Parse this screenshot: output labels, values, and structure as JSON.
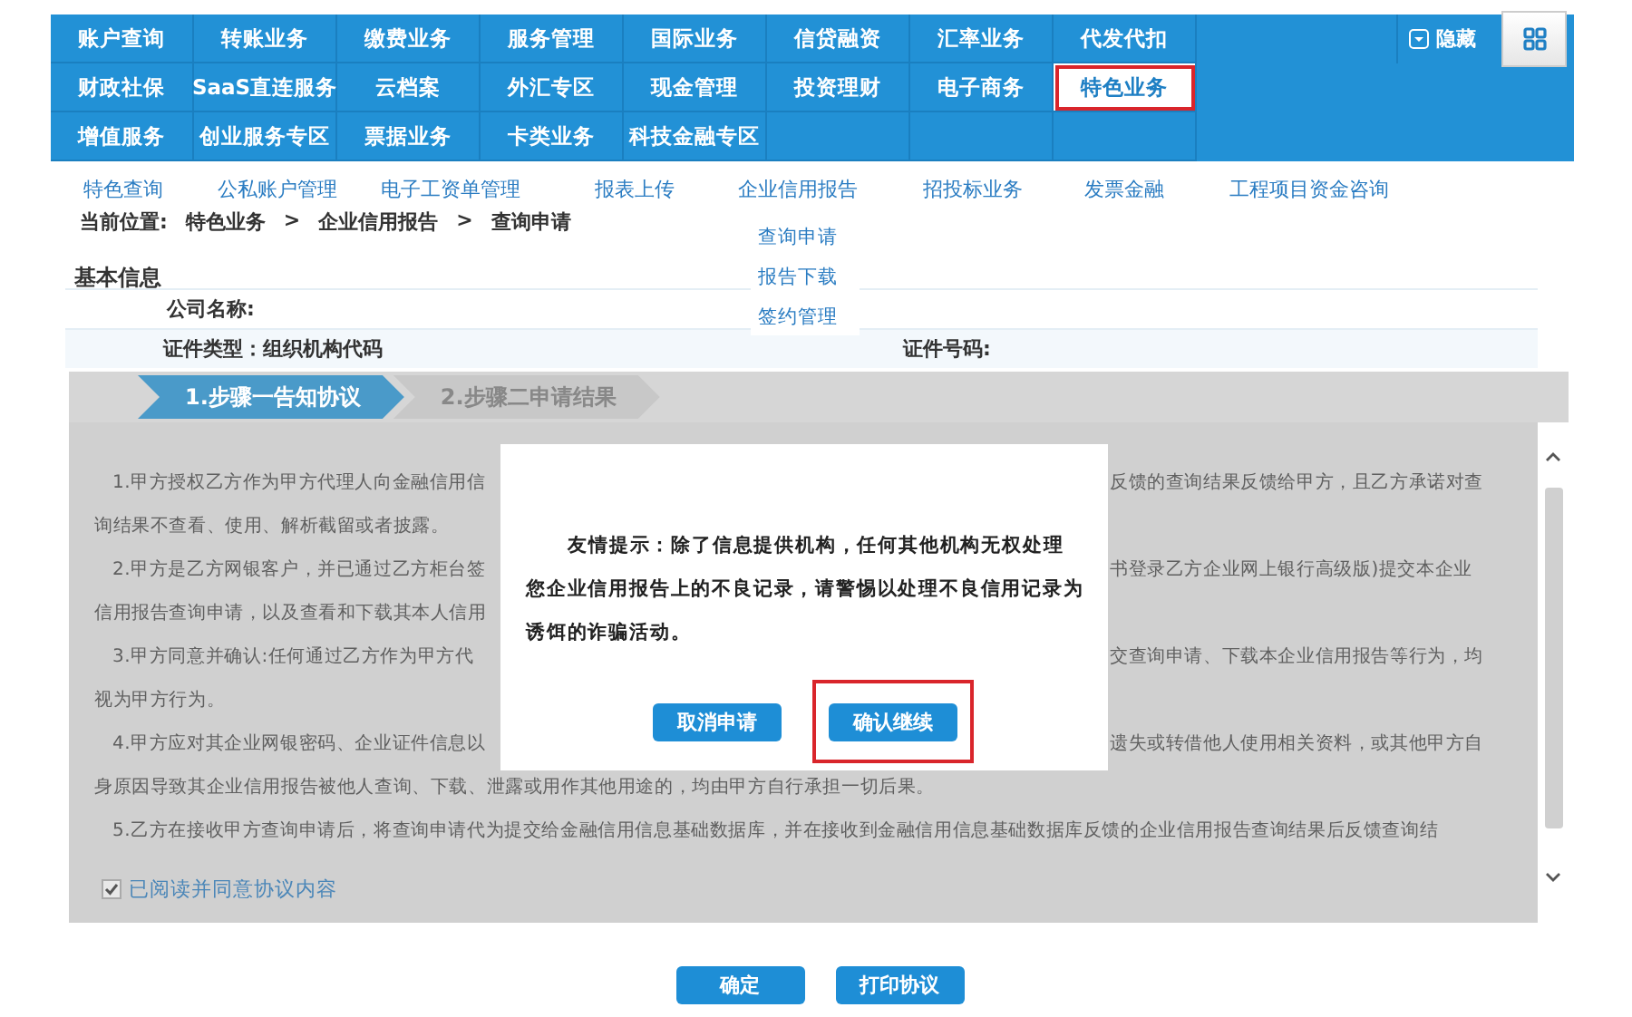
{
  "nav": {
    "rows": [
      [
        {
          "label": "账户查询",
          "selected": false
        },
        {
          "label": "转账业务",
          "selected": false
        },
        {
          "label": "缴费业务",
          "selected": false
        },
        {
          "label": "服务管理",
          "selected": false
        },
        {
          "label": "国际业务",
          "selected": false
        },
        {
          "label": "信贷融资",
          "selected": false
        },
        {
          "label": "汇率业务",
          "selected": false
        },
        {
          "label": "代发代扣",
          "selected": false
        }
      ],
      [
        {
          "label": "财政社保",
          "selected": false
        },
        {
          "label": "SaaS直连服务",
          "selected": false
        },
        {
          "label": "云档案",
          "selected": false
        },
        {
          "label": "外汇专区",
          "selected": false
        },
        {
          "label": "现金管理",
          "selected": false
        },
        {
          "label": "投资理财",
          "selected": false
        },
        {
          "label": "电子商务",
          "selected": false
        },
        {
          "label": "特色业务",
          "selected": true
        }
      ],
      [
        {
          "label": "增值服务",
          "selected": false
        },
        {
          "label": "创业服务专区",
          "selected": false
        },
        {
          "label": "票据业务",
          "selected": false
        },
        {
          "label": "卡类业务",
          "selected": false
        },
        {
          "label": "科技金融专区",
          "selected": false
        }
      ]
    ],
    "hide_toggle": "隐藏"
  },
  "subnav": [
    "特色查询",
    "公私账户管理",
    "电子工资单管理",
    "报表上传",
    "企业信用报告",
    "招投标业务",
    "发票金融",
    "工程项目资金咨询"
  ],
  "dropdown": [
    "查询申请",
    "报告下载",
    "签约管理"
  ],
  "breadcrumb": {
    "label": "当前位置:",
    "path": [
      "特色业务",
      "企业信用报告",
      "查询申请"
    ],
    "separators": [
      ">",
      ">"
    ]
  },
  "basic_info": {
    "title": "基本信息",
    "company_label": "公司名称:",
    "id_type": "证件类型：组织机构代码",
    "id_number_label": "证件号码:"
  },
  "steps": [
    {
      "label": "1.步骤一告知协议",
      "selected": true
    },
    {
      "label": "2.步骤二申请结果",
      "selected": false
    }
  ],
  "agreement": {
    "paragraphs": [
      {
        "lines": [
          {
            "kind": "split",
            "left": "1.甲方授权乙方作为甲方代理人向金融信用信",
            "right": "反馈的查询结果反馈给甲方，且乙方承诺对查"
          },
          {
            "kind": "full",
            "left": "询结果不查看、使用、解析截留或者披露。"
          }
        ]
      },
      {
        "lines": [
          {
            "kind": "split",
            "left": "2.甲方是乙方网银客户，并已通过乙方柜台签",
            "right": "书登录乙方企业网上银行高级版)提交本企业"
          },
          {
            "kind": "split",
            "left": "信用报告查询申请，以及查看和下载其本人信用"
          }
        ]
      },
      {
        "lines": [
          {
            "kind": "split",
            "left": "3.甲方同意并确认:任何通过乙方作为甲方代",
            "right": "交查询申请、下载本企业信用报告等行为，均"
          },
          {
            "kind": "full",
            "left": "视为甲方行为。"
          }
        ]
      },
      {
        "lines": [
          {
            "kind": "split",
            "left": "4.甲方应对其企业网银密码、企业证件信息以",
            "right": "遗失或转借他人使用相关资料，或其他甲方自"
          },
          {
            "kind": "full",
            "left": "身原因导致其企业信用报告被他人查询、下载、泄露或用作其他用途的，均由甲方自行承担一切后果。"
          }
        ]
      },
      {
        "lines": [
          {
            "kind": "full",
            "left": "5.乙方在接收甲方查询申请后，将查询申请代为提交给金融信用信息基础数据库，并在接收到金融信用信息基础数据库反馈的企业信用报告查询结果后反馈查询结"
          }
        ]
      }
    ],
    "consent": {
      "label": "已阅读并同意协议内容",
      "checked": true
    }
  },
  "modal": {
    "message": "友情提示：除了信息提供机构，任何其他机构无权处理您企业信用报告上的不良记录，请警惕以处理不良信用记录为诱饵的诈骗活动。",
    "buttons": [
      {
        "label": "取消申请",
        "highlighted": false
      },
      {
        "label": "确认继续",
        "highlighted": true
      }
    ]
  },
  "buttons": [
    "确定",
    "打印协议"
  ]
}
